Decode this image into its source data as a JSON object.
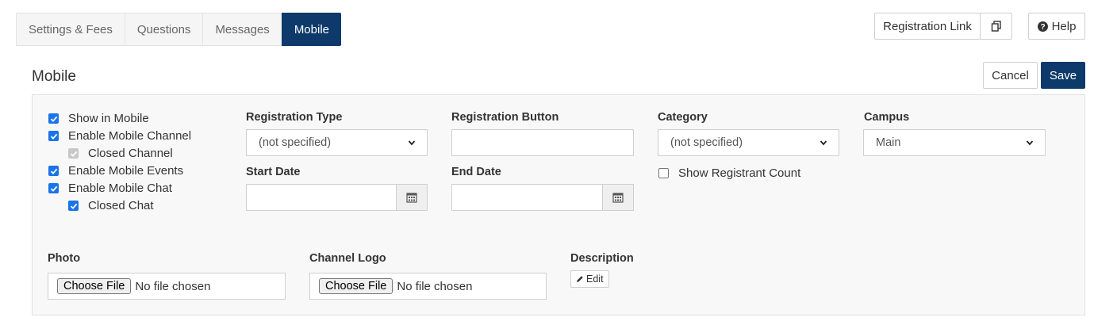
{
  "tabs": [
    {
      "label": "Settings & Fees",
      "active": false
    },
    {
      "label": "Questions",
      "active": false
    },
    {
      "label": "Messages",
      "active": false
    },
    {
      "label": "Mobile",
      "active": true
    }
  ],
  "header": {
    "registration_link_label": "Registration Link",
    "help_label": "Help",
    "title": "Mobile",
    "cancel_label": "Cancel",
    "save_label": "Save"
  },
  "checkboxes": [
    {
      "label": "Show in Mobile",
      "checked": true
    },
    {
      "label": "Enable Mobile Channel",
      "checked": true
    },
    {
      "label": "Closed Channel",
      "checked": true,
      "disabled": true
    },
    {
      "label": "Enable Mobile Events",
      "checked": true
    },
    {
      "label": "Enable Mobile Chat",
      "checked": true
    },
    {
      "label": "Closed Chat",
      "checked": true
    }
  ],
  "fields": {
    "registration_type": {
      "label": "Registration Type",
      "value": "(not specified)"
    },
    "registration_button": {
      "label": "Registration Button",
      "value": ""
    },
    "category": {
      "label": "Category",
      "value": "(not specified)"
    },
    "campus": {
      "label": "Campus",
      "value": "Main"
    },
    "start_date": {
      "label": "Start Date",
      "value": ""
    },
    "end_date": {
      "label": "End Date",
      "value": ""
    },
    "show_registrant_count": {
      "label": "Show Registrant Count",
      "checked": false
    }
  },
  "uploads": {
    "photo": {
      "label": "Photo",
      "button": "Choose File",
      "status": "No file chosen"
    },
    "channel_logo": {
      "label": "Channel Logo",
      "button": "Choose File",
      "status": "No file chosen"
    }
  },
  "description": {
    "label": "Description",
    "edit_label": "Edit"
  },
  "colors": {
    "accent": "#0d3a6a",
    "checkbox": "#1a73e8"
  }
}
